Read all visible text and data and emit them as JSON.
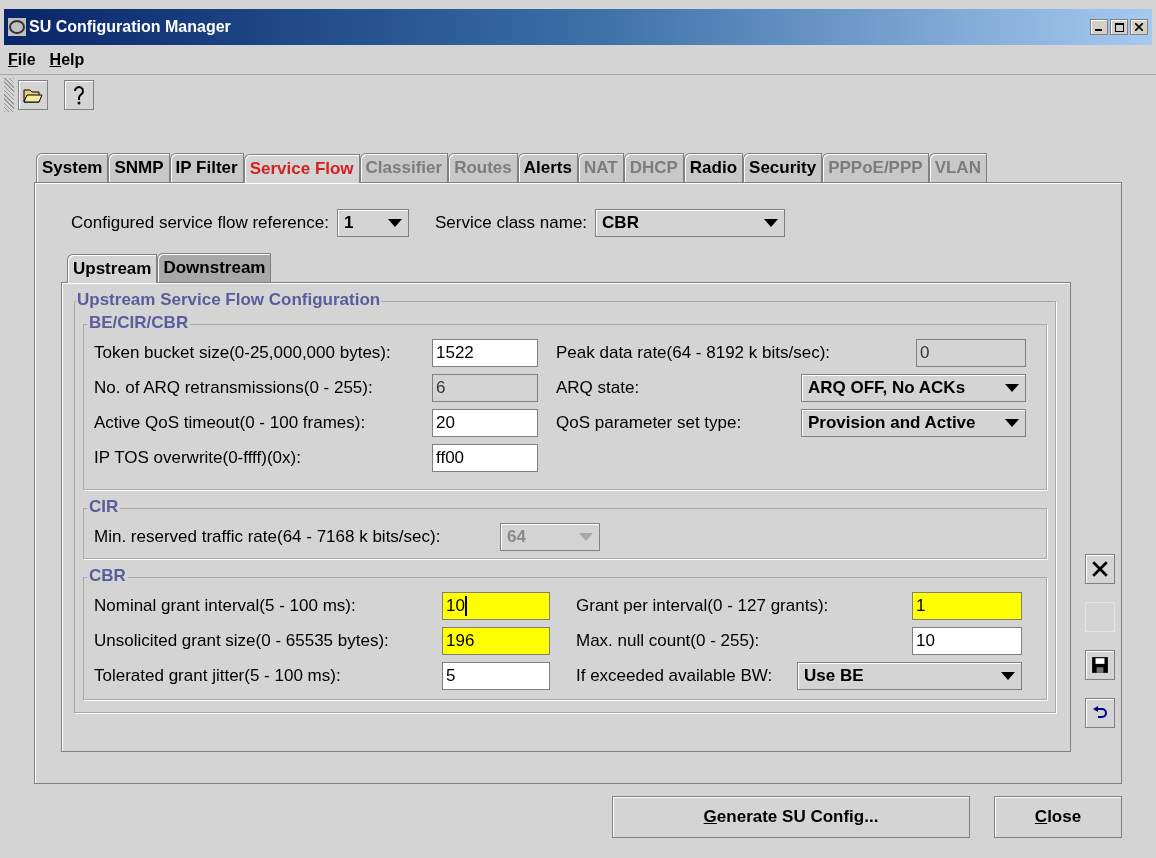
{
  "window": {
    "title": "SU Configuration Manager"
  },
  "menu": [
    {
      "label": "File",
      "mnemonic": true
    },
    {
      "label": "Help",
      "mnemonic": true
    }
  ],
  "tabs": [
    {
      "label": "System",
      "selected": false,
      "disabled": false
    },
    {
      "label": "SNMP",
      "selected": false,
      "disabled": false
    },
    {
      "label": "IP Filter",
      "selected": false,
      "disabled": false
    },
    {
      "label": "Service Flow",
      "selected": true,
      "disabled": false
    },
    {
      "label": "Classifier",
      "selected": false,
      "disabled": true
    },
    {
      "label": "Routes",
      "selected": false,
      "disabled": true
    },
    {
      "label": "Alerts",
      "selected": false,
      "disabled": false
    },
    {
      "label": "NAT",
      "selected": false,
      "disabled": true
    },
    {
      "label": "DHCP",
      "selected": false,
      "disabled": true
    },
    {
      "label": "Radio",
      "selected": false,
      "disabled": false
    },
    {
      "label": "Security",
      "selected": false,
      "disabled": false
    },
    {
      "label": "PPPoE/PPP",
      "selected": false,
      "disabled": true
    },
    {
      "label": "VLAN",
      "selected": false,
      "disabled": true
    }
  ],
  "reference": {
    "label": "Configured service flow reference:",
    "value": "1"
  },
  "service_class": {
    "label": "Service class name:",
    "value": "CBR"
  },
  "subtabs": [
    {
      "label": "Upstream",
      "selected": true
    },
    {
      "label": "Downstream",
      "selected": false
    }
  ],
  "panel_title": "Upstream Service Flow Configuration",
  "groups": [
    {
      "title": "BE/CIR/CBR",
      "columns": [
        [
          {
            "label": "Token bucket size(0-25,000,000 bytes):",
            "kind": "text",
            "value": "1522",
            "enabled": true,
            "highlighted": false,
            "focused": false
          },
          {
            "label": "No. of ARQ retransmissions(0 - 255):",
            "kind": "text",
            "value": "6",
            "enabled": false,
            "highlighted": false,
            "focused": false
          },
          {
            "label": "Active QoS timeout(0 - 100 frames):",
            "kind": "text",
            "value": "20",
            "enabled": true,
            "highlighted": false,
            "focused": false
          },
          {
            "label": "IP TOS overwrite(0-ffff)(0x):",
            "kind": "text",
            "value": "ff00",
            "enabled": true,
            "highlighted": false,
            "focused": false
          }
        ],
        [
          {
            "label": "Peak data rate(64 - 8192 k bits/sec):",
            "kind": "text",
            "value": "0",
            "enabled": false,
            "highlighted": false,
            "focused": false
          },
          {
            "label": "ARQ state:",
            "kind": "combo",
            "value": "ARQ OFF, No ACKs",
            "enabled": true
          },
          {
            "label": "QoS parameter set type:",
            "kind": "combo",
            "value": "Provision and Active",
            "enabled": true
          }
        ]
      ]
    },
    {
      "title": "CIR",
      "columns": [
        [
          {
            "label": "Min. reserved traffic rate(64 - 7168 k bits/sec):",
            "kind": "combo",
            "value": "64",
            "enabled": false
          }
        ]
      ]
    },
    {
      "title": "CBR",
      "columns": [
        [
          {
            "label": "Nominal grant interval(5 - 100 ms):",
            "kind": "text",
            "value": "10",
            "enabled": true,
            "highlighted": true,
            "focused": true
          },
          {
            "label": "Unsolicited grant size(0 - 65535 bytes):",
            "kind": "text",
            "value": "196",
            "enabled": true,
            "highlighted": true,
            "focused": false
          },
          {
            "label": "Tolerated grant jitter(5 - 100 ms):",
            "kind": "text",
            "value": "5",
            "enabled": true,
            "highlighted": false,
            "focused": false
          }
        ],
        [
          {
            "label": "Grant per interval(0 - 127 grants):",
            "kind": "text",
            "value": "1",
            "enabled": true,
            "highlighted": true,
            "focused": false
          },
          {
            "label": "Max. null count(0 - 255):",
            "kind": "text",
            "value": "10",
            "enabled": true,
            "highlighted": false,
            "focused": false
          },
          {
            "label": "If exceeded available BW:",
            "kind": "combo",
            "value": "Use BE",
            "enabled": true
          }
        ]
      ]
    }
  ],
  "side_buttons": [
    {
      "kind": "delete",
      "disabled": false
    },
    {
      "kind": "blank",
      "disabled": true
    },
    {
      "kind": "save",
      "disabled": false
    },
    {
      "kind": "undo",
      "disabled": false
    }
  ],
  "buttons": [
    {
      "label": "Generate SU Config...",
      "mnemonic": true
    },
    {
      "label": "Close",
      "mnemonic": true
    }
  ]
}
